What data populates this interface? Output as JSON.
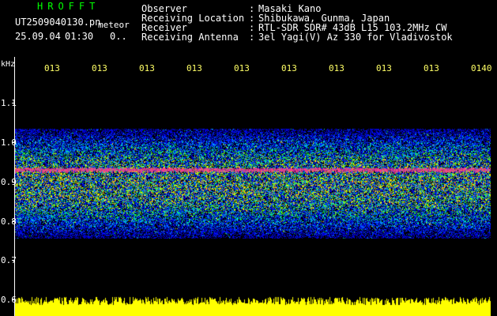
{
  "header": {
    "app_title": "HROFFT",
    "file_name": "UT2509040130.pn",
    "meteor_label": "meteor",
    "date": "25.09.04",
    "time": "01:30",
    "count": "0.."
  },
  "info": [
    {
      "key": "Observer",
      "sep": ":",
      "value": "Masaki Kano"
    },
    {
      "key": "Receiving Location",
      "sep": ":",
      "value": "Shibukawa, Gunma, Japan"
    },
    {
      "key": "Receiver",
      "sep": ":",
      "value": "RTL-SDR SDR# 43dB L15 103.2MHz CW"
    },
    {
      "key": "Receiving Antenna",
      "sep": ":",
      "value": "3el Yagi(V) Az 330 for Vladivostok"
    }
  ],
  "axes": {
    "y_unit": "kHz",
    "y_ticks": [
      "1.1",
      "1.0",
      "0.9",
      "0.8",
      "0.7",
      "0.6"
    ],
    "x_ticks": [
      "013",
      "013",
      "013",
      "013",
      "013",
      "013",
      "013",
      "013",
      "013",
      "0140"
    ]
  },
  "colors": {
    "title": "#00ff00",
    "time_ticks": "#ffff66",
    "signal_line": "#ff3c8c",
    "noise_floor": "#ffff00"
  }
}
